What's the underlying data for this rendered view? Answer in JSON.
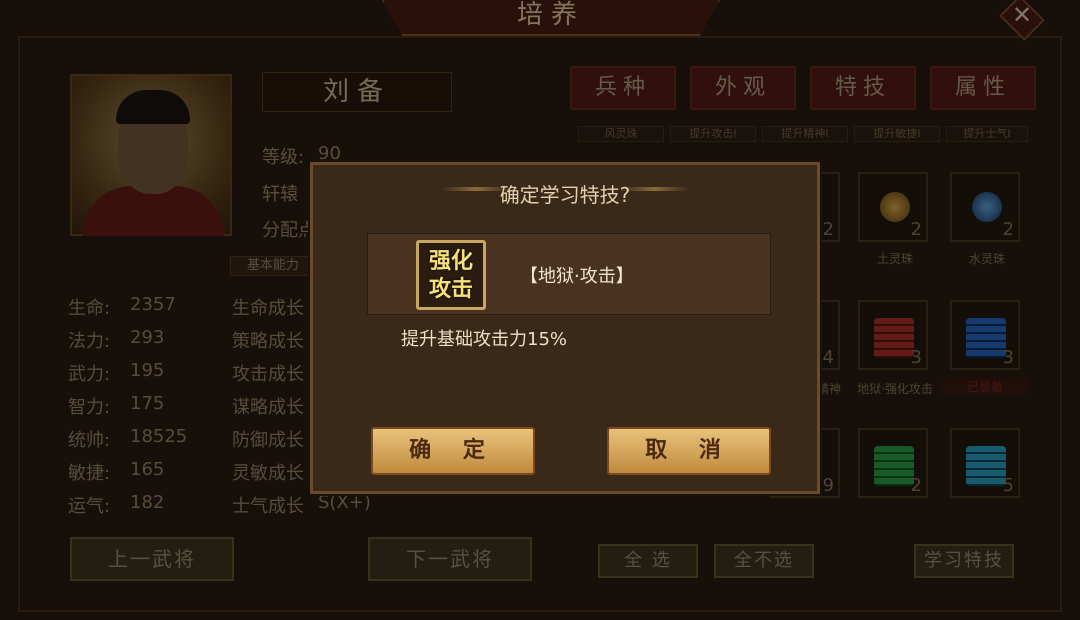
{
  "window": {
    "title": "培养",
    "close_label": "✕"
  },
  "hero": {
    "name": "刘备",
    "level_label": "等级:",
    "level_value": "90",
    "rank": "轩辕",
    "points_label": "分配点"
  },
  "section": {
    "basic_label": "基本能力"
  },
  "stats": [
    {
      "label": "生命:",
      "value": "2357"
    },
    {
      "label": "法力:",
      "value": "293"
    },
    {
      "label": "武力:",
      "value": "195"
    },
    {
      "label": "智力:",
      "value": "175"
    },
    {
      "label": "统帅:",
      "value": "18525"
    },
    {
      "label": "敏捷:",
      "value": "165"
    },
    {
      "label": "运气:",
      "value": "182"
    }
  ],
  "growth": [
    {
      "label": "生命成长"
    },
    {
      "label": "策略成长"
    },
    {
      "label": "攻击成长"
    },
    {
      "label": "谋略成长"
    },
    {
      "label": "防御成长"
    },
    {
      "label": "灵敏成长"
    },
    {
      "label": "士气成长",
      "value": "S(X+)"
    }
  ],
  "nav": {
    "prev": "上一武将",
    "next": "下一武将"
  },
  "tabs": [
    "兵种",
    "外观",
    "特技",
    "属性"
  ],
  "subtabs": [
    "风灵珠",
    "提升攻击Ⅰ",
    "提升精神Ⅰ",
    "提升敏捷Ⅰ",
    "提升士气Ⅰ"
  ],
  "inventory": {
    "row1": [
      {
        "count": "2"
      },
      {
        "count": "2",
        "label": "土灵珠"
      },
      {
        "count": "2",
        "label": "水灵珠"
      }
    ],
    "row2": [
      {
        "count": "4",
        "label": "精神"
      },
      {
        "count": "3",
        "label": "地狱·强化攻击"
      },
      {
        "count": "3",
        "label": "已装备"
      }
    ],
    "row3": [
      {
        "count": "9"
      },
      {
        "count": "2"
      },
      {
        "count": "5"
      }
    ]
  },
  "actions": {
    "select_all": "全 选",
    "select_none": "全不选",
    "learn": "学习特技"
  },
  "dialog": {
    "title": "确定学习特技?",
    "skill_icon_text": "强化攻击",
    "skill_name": "【地狱·攻击】",
    "description": "提升基础攻击力15%",
    "confirm": "确 定",
    "cancel": "取 消"
  },
  "colors": {
    "gold": "#d9a650",
    "dark_red": "#5a1c16"
  }
}
